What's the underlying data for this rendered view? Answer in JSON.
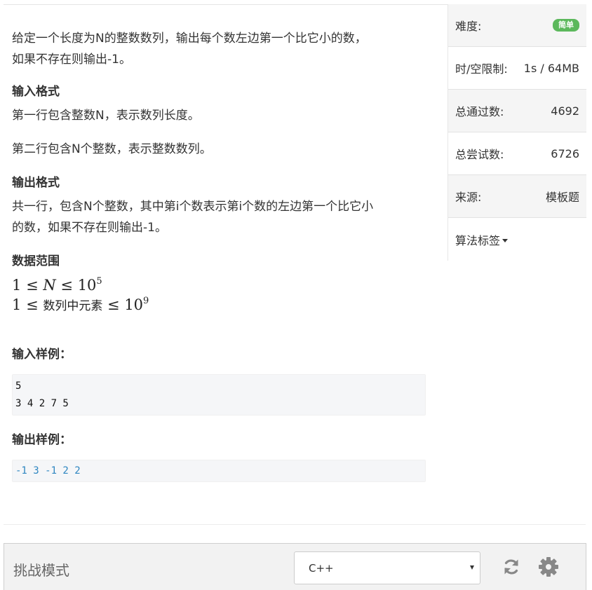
{
  "problem": {
    "description": [
      "给定一个长度为N的整数数列，输出每个数左边第一个比它小的数，",
      "如果不存在则输出-1。"
    ],
    "input_format": {
      "heading": "输入格式",
      "lines": [
        "第一行包含整数N，表示数列长度。",
        "第二行包含N个整数，表示整数数列。"
      ]
    },
    "output_format": {
      "heading": "输出格式",
      "lines": [
        "共一行，包含N个整数，其中第i个数表示第i个数的左边第一个比它小",
        "的数，如果不存在则输出-1。"
      ]
    },
    "data_range": {
      "heading": "数据范围",
      "line1": {
        "left": "1",
        "var": "N",
        "base": "10",
        "exp": "5"
      },
      "line2": {
        "left": "1",
        "text": "数列中元素",
        "base": "10",
        "exp": "9"
      }
    },
    "sample_input": {
      "heading": "输入样例：",
      "code": "5\n3 4 2 7 5"
    },
    "sample_output": {
      "heading": "输出样例：",
      "code": "-1 3 -1 2 2"
    }
  },
  "sidebar": {
    "difficulty_label": "难度:",
    "difficulty_badge": "简单",
    "difficulty_color": "#5cb85c",
    "limit_label": "时/空限制:",
    "limit_value": "1s / 64MB",
    "passed_label": "总通过数:",
    "passed_value": "4692",
    "attempts_label": "总尝试数:",
    "attempts_value": "6726",
    "source_label": "来源:",
    "source_value": "模板题",
    "tags_label": "算法标签"
  },
  "toolbar": {
    "mode_label": "挑战模式",
    "language": "C++",
    "reset_icon": "refresh-icon",
    "settings_icon": "gear-icon"
  }
}
